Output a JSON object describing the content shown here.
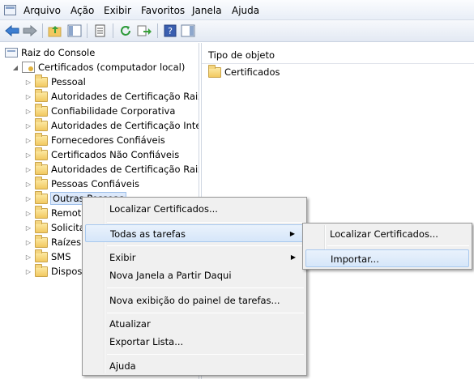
{
  "menubar": {
    "items": [
      "Arquivo",
      "Ação",
      "Exibir",
      "Favoritos",
      "Janela",
      "Ajuda"
    ]
  },
  "toolbar": {
    "buttons": [
      "back-arrow-icon",
      "forward-arrow-icon",
      "up-folder-icon",
      "show-hide-tree-icon",
      "properties-icon",
      "refresh-icon",
      "export-list-icon",
      "help-icon",
      "show-hide-action-pane-icon"
    ]
  },
  "tree": {
    "root": "Raiz do Console",
    "store": "Certificados (computador local)",
    "folders": [
      "Pessoal",
      "Autoridades de Certificação Raiz Confiáveis",
      "Confiabilidade Corporativa",
      "Autoridades de Certificação Intermediárias",
      "Fornecedores Confiáveis",
      "Certificados Não Confiáveis",
      "Autoridades de Certificação Raiz de Terceiros",
      "Pessoas Confiáveis",
      "Outras Pessoas",
      "Remota",
      "Solicitações",
      "Raízes",
      "SMS",
      "Dispositivos"
    ]
  },
  "list": {
    "column_header": "Tipo de objeto",
    "items": [
      "Certificados"
    ]
  },
  "context_menu": {
    "items": {
      "find": "Localizar Certificados...",
      "all_tasks": "Todas as tarefas",
      "view": "Exibir",
      "new_window": "Nova Janela a Partir Daqui",
      "new_taskpad": "Nova exibição do painel de tarefas...",
      "refresh": "Atualizar",
      "export": "Exportar Lista...",
      "help": "Ajuda"
    }
  },
  "submenu": {
    "items": {
      "find": "Localizar Certificados...",
      "import": "Importar..."
    }
  },
  "colors": {
    "accent": "#3b6db5",
    "highlight": "#d6e6f9"
  }
}
